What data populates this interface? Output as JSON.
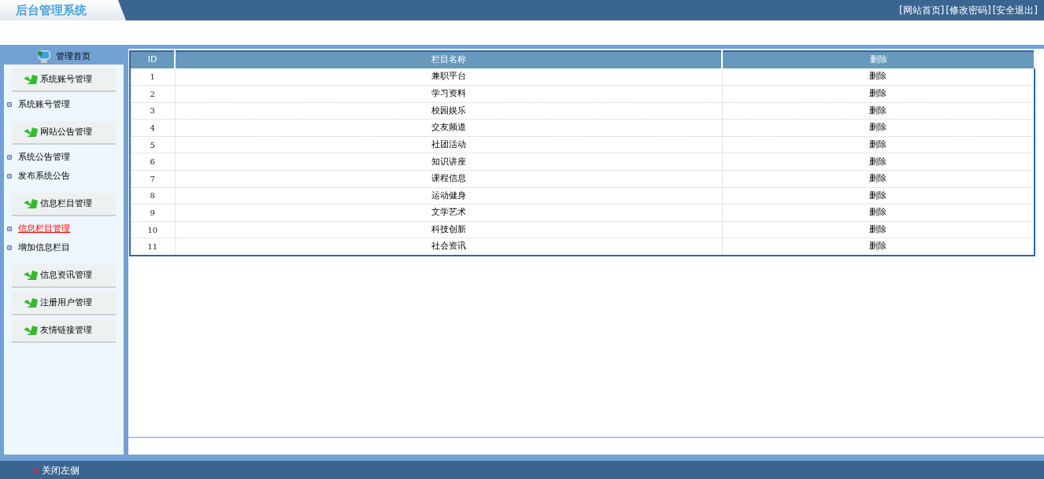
{
  "header": {
    "logo": "后台管理系统",
    "links": [
      "[网站首页]",
      "[修改密码]",
      "[安全退出]"
    ]
  },
  "sidebar": {
    "home": "管理首页",
    "groups": [
      {
        "title": "系统账号管理",
        "items": [
          {
            "label": "系统账号管理",
            "selected": false
          }
        ]
      },
      {
        "title": "网站公告管理",
        "items": [
          {
            "label": "系统公告管理",
            "selected": false
          },
          {
            "label": "发布系统公告",
            "selected": false
          }
        ]
      },
      {
        "title": "信息栏目管理",
        "items": [
          {
            "label": "信息栏目管理",
            "selected": true
          },
          {
            "label": "增加信息栏目",
            "selected": false
          }
        ]
      },
      {
        "title": "信息资讯管理"
      },
      {
        "title": "注册用户管理"
      },
      {
        "title": "友情链接管理"
      }
    ]
  },
  "table": {
    "columns": [
      "ID",
      "栏目名称",
      "删除"
    ],
    "rows": [
      [
        "1",
        "兼职平台",
        "删除"
      ],
      [
        "2",
        "学习资料",
        "删除"
      ],
      [
        "3",
        "校园娱乐",
        "删除"
      ],
      [
        "4",
        "交友频道",
        "删除"
      ],
      [
        "5",
        "社团活动",
        "删除"
      ],
      [
        "6",
        "知识讲座",
        "删除"
      ],
      [
        "7",
        "课程信息",
        "删除"
      ],
      [
        "8",
        "运动健身",
        "删除"
      ],
      [
        "9",
        "文学艺术",
        "删除"
      ],
      [
        "10",
        "科技创新",
        "删除"
      ],
      [
        "11",
        "社会资讯",
        "删除"
      ]
    ]
  },
  "footer": {
    "toggle": "关闭左侧"
  }
}
